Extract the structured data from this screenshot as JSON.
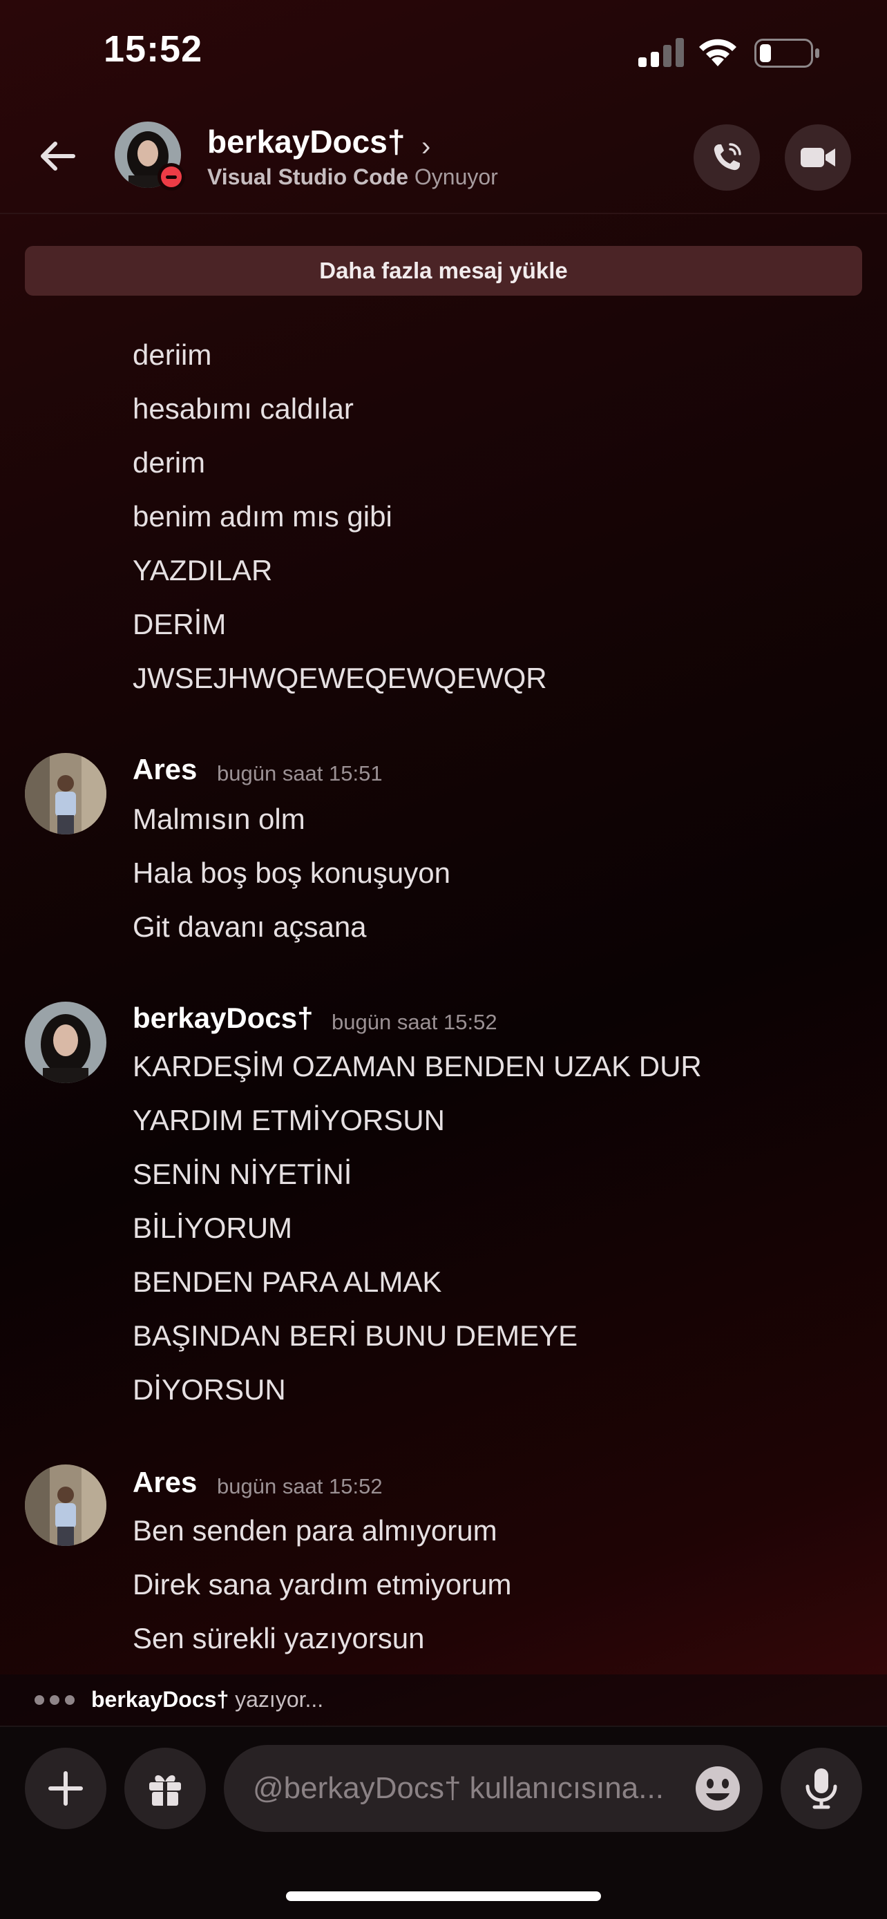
{
  "status_bar": {
    "time": "15:52"
  },
  "header": {
    "name": "berkayDocs†",
    "chevron": "›",
    "activity_app": "Visual Studio Code",
    "activity_suffix": "Oynuyor"
  },
  "load_more_label": "Daha fazla mesaj yükle",
  "orphan_lines": [
    "deriim",
    "hesabımı caldılar",
    "derim",
    "benim adım mıs gibi",
    "YAZDILAR",
    "DERİM",
    "JWSEJHWQEWEQEWQEWQR"
  ],
  "groups": [
    {
      "author": "Ares",
      "time": "bugün saat 15:51",
      "lines": [
        "Malmısın olm",
        "Hala boş boş konuşuyon",
        "Git davanı açsana"
      ]
    },
    {
      "author": "berkayDocs†",
      "time": "bugün saat 15:52",
      "lines": [
        "KARDEŞİM OZAMAN BENDEN UZAK DUR",
        "YARDIM ETMİYORSUN",
        "SENİN NİYETİNİ",
        "BİLİYORUM",
        "BENDEN PARA ALMAK",
        "BAŞINDAN BERİ BUNU DEMEYE",
        "DİYORSUN"
      ]
    },
    {
      "author": "Ares",
      "time": "bugün saat 15:52",
      "lines": [
        "Ben senden para almıyorum",
        "Direk sana yardım etmiyorum",
        "Sen sürekli yazıyorsun"
      ]
    }
  ],
  "typing": {
    "name": "berkayDocs†",
    "text": "yazıyor..."
  },
  "composer": {
    "placeholder": "@berkayDocs† kullanıcısına..."
  },
  "colors": {
    "accent_red": "#ed3c46",
    "background": "#1a0506",
    "load_more_bg": "#4b2426"
  }
}
